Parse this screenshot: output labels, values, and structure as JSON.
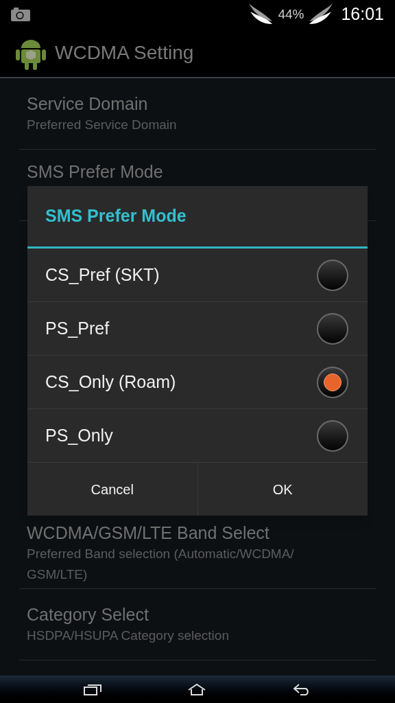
{
  "status_bar": {
    "battery": "44%",
    "time": "16:01"
  },
  "action_bar": {
    "title": "WCDMA Setting"
  },
  "settings_top": [
    {
      "title": "Service Domain",
      "subtitle": "Preferred Service Domain"
    },
    {
      "title": "SMS Prefer Mode"
    }
  ],
  "settings_bottom": [
    {
      "title": "WCDMA/GSM/LTE Band Select",
      "subtitle": "Preferred Band selection (Automatic/WCDMA/ GSM/LTE)"
    },
    {
      "title": "Category Select",
      "subtitle": "HSDPA/HSUPA Category selection"
    }
  ],
  "dialog": {
    "title": "SMS Prefer Mode",
    "options": [
      {
        "label": "CS_Pref (SKT)",
        "selected": false
      },
      {
        "label": "PS_Pref",
        "selected": false
      },
      {
        "label": "CS_Only (Roam)",
        "selected": true
      },
      {
        "label": "PS_Only",
        "selected": false
      }
    ],
    "buttons": [
      "Cancel",
      "OK"
    ]
  }
}
